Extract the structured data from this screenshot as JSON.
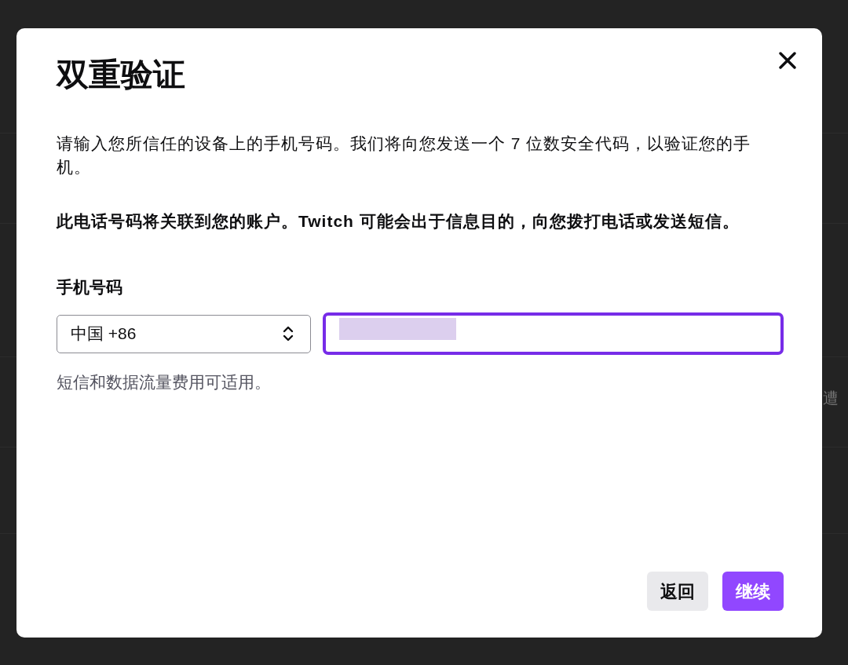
{
  "background": {
    "text": "遭"
  },
  "dialog": {
    "title": "双重验证",
    "description": "请输入您所信任的设备上的手机号码。我们将向您发送一个 7 位数安全代码，以验证您的手机。",
    "notice": "此电话号码将关联到您的账户。Twitch 可能会出于信息目的，向您拨打电话或发送短信。",
    "phone_label": "手机号码",
    "country_select": {
      "value": "中国 +86"
    },
    "phone_input": {
      "focused": true,
      "redacted": true
    },
    "hint": "短信和数据流量费用可适用。",
    "buttons": [
      {
        "label": "返回",
        "kind": "secondary"
      },
      {
        "label": "继续",
        "kind": "primary"
      }
    ]
  }
}
